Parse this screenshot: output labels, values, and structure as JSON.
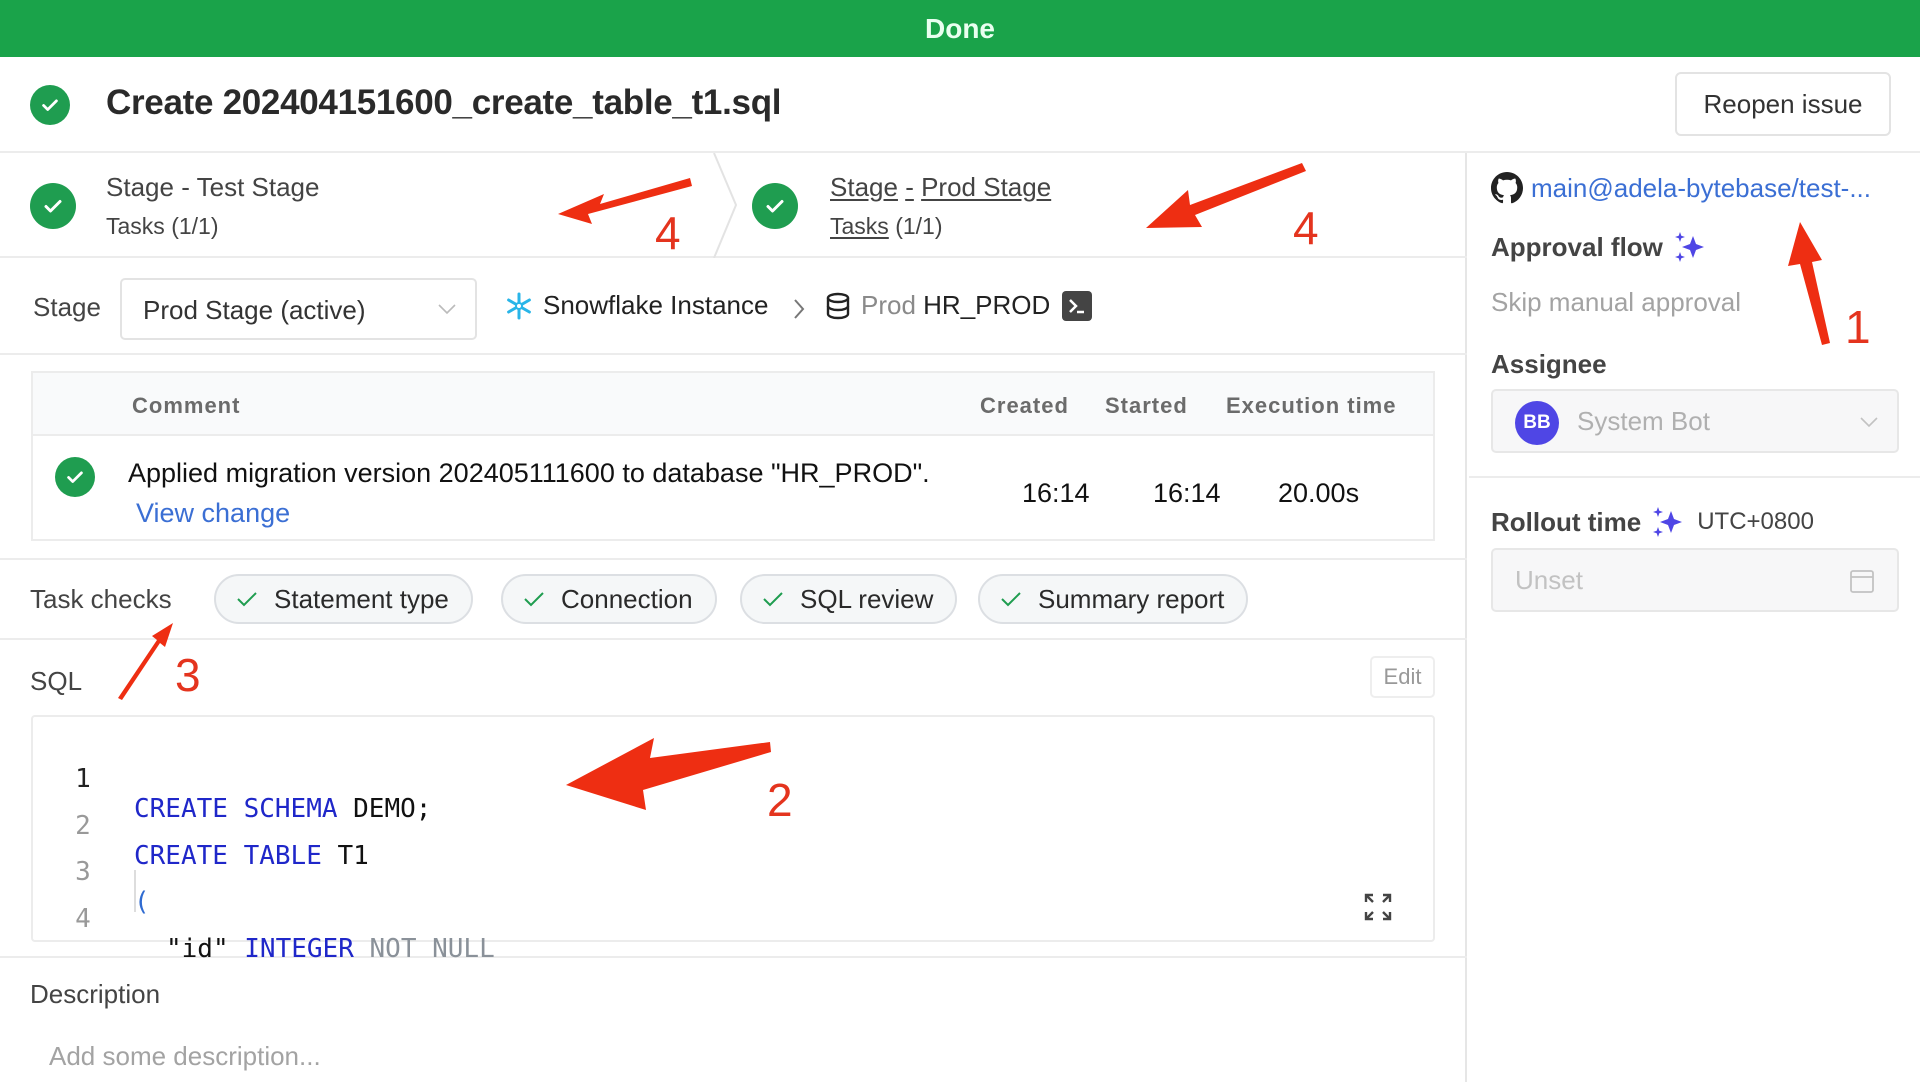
{
  "status_bar": {
    "label": "Done",
    "color": "#1aa34a"
  },
  "header": {
    "status_icon": "check-circle-icon",
    "title": "Create 202404151600_create_table_t1.sql",
    "reopen_button": "Reopen issue"
  },
  "stages": [
    {
      "title_prefix": "Stage",
      "title_sep": "-",
      "title_name": "Test Stage",
      "tasks_label": "Tasks",
      "tasks_count": "(1/1)",
      "status": "done",
      "active": false
    },
    {
      "title_prefix": "Stage",
      "title_sep": "-",
      "title_name": "Prod Stage",
      "tasks_label": "Tasks",
      "tasks_count": "(1/1)",
      "status": "done",
      "active": true
    }
  ],
  "stage_selector": {
    "label": "Stage",
    "value": "Prod Stage (active)",
    "instance": "Snowflake Instance",
    "env": "Prod",
    "database": "HR_PROD"
  },
  "task_runs": {
    "columns": [
      "Comment",
      "Created",
      "Started",
      "Execution time"
    ],
    "rows": [
      {
        "comment": "Applied migration version 202405111600 to database \"HR_PROD\".",
        "link": "View change",
        "created": "16:14",
        "started": "16:14",
        "execution_time": "20.00s",
        "status": "success"
      }
    ]
  },
  "task_checks": {
    "label": "Task checks",
    "items": [
      "Statement type",
      "Connection",
      "SQL review",
      "Summary report"
    ]
  },
  "sql": {
    "label": "SQL",
    "edit_button": "Edit",
    "lines": [
      {
        "num": "1",
        "tokens": [
          "CREATE",
          "SCHEMA",
          "DEMO;"
        ]
      },
      {
        "num": "2",
        "tokens": [
          "CREATE",
          "TABLE",
          "T1"
        ]
      },
      {
        "num": "3",
        "tokens": [
          "("
        ]
      },
      {
        "num": "4",
        "tokens": [
          "\"id\"",
          "INTEGER",
          "NOT NULL"
        ]
      }
    ]
  },
  "description": {
    "label": "Description",
    "placeholder": "Add some description..."
  },
  "sidebar": {
    "repo_link": "main@adela-bytebase/test-...",
    "approval_flow": {
      "label": "Approval flow",
      "value": "Skip manual approval"
    },
    "assignee": {
      "label": "Assignee",
      "avatar_initials": "BB",
      "value": "System Bot"
    },
    "rollout_time": {
      "label": "Rollout time",
      "timezone": "UTC+0800",
      "placeholder": "Unset"
    }
  },
  "annotations": [
    "1",
    "2",
    "3",
    "4",
    "4"
  ],
  "colors": {
    "success": "#1f9d50",
    "link": "#3b6fd4",
    "accent": "#4f46e5",
    "annotation": "#e4341e"
  }
}
